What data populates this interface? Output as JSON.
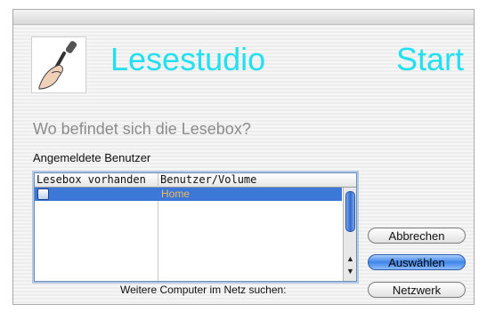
{
  "app": {
    "title": "Lesestudio",
    "start_label": "Start",
    "logo_icon": "microphone-hand-icon"
  },
  "question": "Wo befindet sich die Lesebox?",
  "users_section": {
    "label": "Angemeldete Benutzer",
    "columns": [
      "Lesebox vorhanden",
      "Benutzer/Volume"
    ],
    "rows": [
      {
        "has_lesebox": false,
        "user_volume": "Home",
        "selected": true
      }
    ]
  },
  "buttons": {
    "cancel": "Abbrechen",
    "select": "Auswählen",
    "network": "Netzwerk"
  },
  "network_search_label": "Weitere Computer im Netz suchen:",
  "colors": {
    "accent": "#22e0f0",
    "selection": "#3c78d8",
    "home_text": "#f5b95a"
  }
}
